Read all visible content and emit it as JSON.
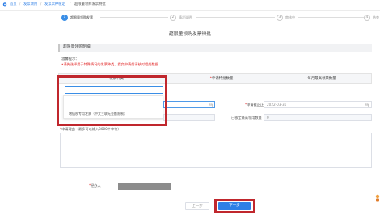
{
  "breadcrumb": {
    "items": [
      "首页",
      "发票领用",
      "发票票种核定",
      "超限量领购发票特批"
    ]
  },
  "steps": [
    {
      "num": "1",
      "label": "超限量领购发票",
      "state": "active"
    },
    {
      "num": "2",
      "label": "情况说明",
      "state": "todo"
    },
    {
      "num": "3",
      "label": "审核中",
      "state": "todo"
    },
    {
      "num": "4",
      "label": "结束",
      "state": "todo"
    }
  ],
  "page_title": "超限量领购发票特批",
  "section_title": "超限量领购明细",
  "tips": {
    "title": "温馨提示：",
    "line": "•请先选择用于特殊情况的发票种类，提交申请前请核对相关数据"
  },
  "table": {
    "headers": [
      "发票种类",
      "申请特批数量",
      "每月最高领票数量"
    ]
  },
  "dropdown": {
    "option": "增值税专用发票（中文三联无金额限制）"
  },
  "fields": {
    "end_date_label": "申请截止止",
    "end_date_value": "2022-03-31",
    "approved_label": "已核定最高领用数量",
    "approved_value": "0",
    "reason_label": "申请理由（最多可以输入3000个字符）",
    "handler_label": "经办人"
  },
  "buttons": {
    "prev": "上一步",
    "next": "下一步"
  },
  "colors": {
    "accent": "#2f7fe6",
    "highlight": "#c0272d",
    "required": "#e02020"
  }
}
